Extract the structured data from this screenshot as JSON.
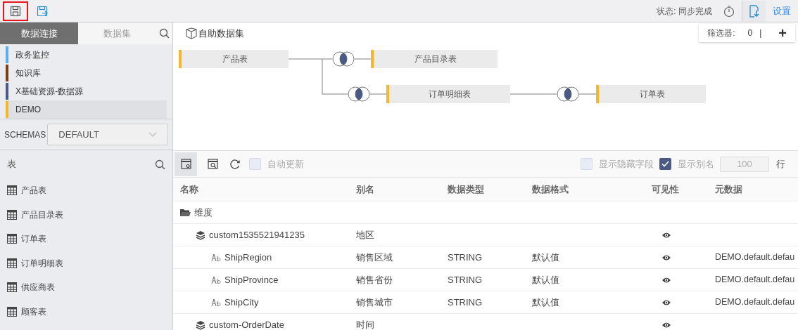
{
  "toolbar": {
    "buttons": [
      {
        "kind": "save",
        "selected": true
      },
      {
        "kind": "save_as",
        "selected": false
      }
    ],
    "status": "状态: 同步完成",
    "settings": "设置"
  },
  "sidebar": {
    "tabs": [
      {
        "label": "数据连接",
        "selected": true
      },
      {
        "label": "数据集",
        "selected": false
      }
    ],
    "connections": [
      {
        "name": "政务监控",
        "color": "#5aaef0",
        "selected": false
      },
      {
        "name": "知识库",
        "color": "#7a3d14",
        "selected": false
      },
      {
        "name": "X基础资源-数据源",
        "color": "#4a5a85",
        "selected": false
      },
      {
        "name": "DEMO",
        "color": "#f4b62a",
        "selected": true
      }
    ],
    "schemas": {
      "label": "SCHEMAS",
      "value": "DEFAULT"
    },
    "tables_title": "表",
    "tables": [
      "产品表",
      "产品目录表",
      "订单表",
      "订单明细表",
      "供应商表",
      "顾客表"
    ]
  },
  "canvas": {
    "title": "自助数据集",
    "filter": {
      "label": "筛选器:",
      "count": "0",
      "separator": "|",
      "add": "+"
    },
    "diagram": {
      "label": "产品表",
      "children": [
        {
          "label": "产品目录表"
        },
        {
          "label": "订单明细表",
          "children": [
            {
              "label": "订单表"
            }
          ]
        }
      ]
    }
  },
  "fields": {
    "auto_update": {
      "label": "自动更新",
      "checked": false
    },
    "show_hidden": {
      "label": "显示隐藏字段",
      "checked": false
    },
    "show_alias": {
      "label": "显示别名",
      "checked": true
    },
    "row_count": "100",
    "row_unit": "行",
    "columns": [
      "名称",
      "别名",
      "数据类型",
      "数据格式",
      "可见性",
      "元数据"
    ],
    "rows": [
      {
        "kind": "group",
        "name": "维度",
        "children": [
          {
            "kind": "dimension",
            "name": "custom1535521941235",
            "alias": "地区",
            "visible": true,
            "children": [
              {
                "kind": "field",
                "name": "ShipRegion",
                "alias": "销售区域",
                "type": "STRING",
                "format": "默认值",
                "visible": true,
                "meta": "DEMO.default.defau"
              },
              {
                "kind": "field",
                "name": "ShipProvince",
                "alias": "销售省份",
                "type": "STRING",
                "format": "默认值",
                "visible": true,
                "meta": "DEMO.default.defau"
              },
              {
                "kind": "field",
                "name": "ShipCity",
                "alias": "销售城市",
                "type": "STRING",
                "format": "默认值",
                "visible": true,
                "meta": "DEMO.default.defau"
              }
            ]
          },
          {
            "kind": "dimension",
            "name": "custom-OrderDate",
            "alias": "时间",
            "visible": true
          }
        ]
      }
    ]
  }
}
